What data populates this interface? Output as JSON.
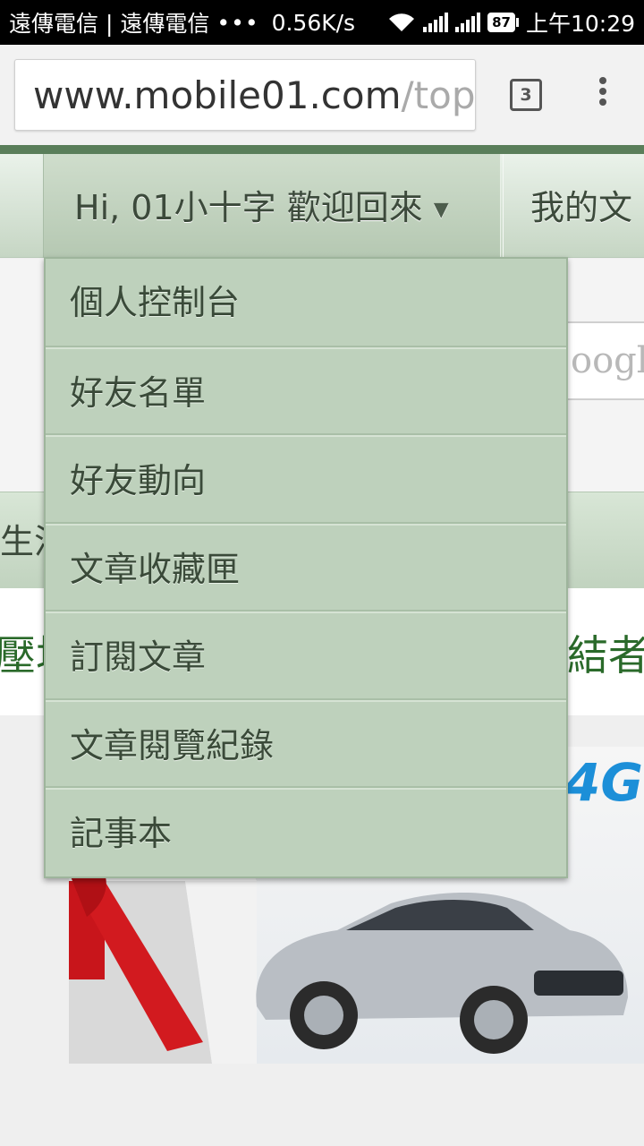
{
  "status_bar": {
    "carriers": "遠傳電信 | 遠傳電信",
    "more": "•••",
    "speed": "0.56K/s",
    "battery": "87",
    "time": "上午10:29"
  },
  "browser": {
    "url_host": "www.mobile01.com",
    "url_path": "/topic",
    "tab_count": "3"
  },
  "nav": {
    "user_greeting": "Hi, 01小十字 歡迎回來",
    "caret": "▼",
    "my_posts": "我的文"
  },
  "search_partial": "oogl",
  "category_partial": "生活",
  "headline": {
    "left_partial": "壓垃",
    "right_partial": "結者"
  },
  "ad": {
    "brand_text": "4G"
  },
  "dropdown": {
    "items": [
      "個人控制台",
      "好友名單",
      "好友動向",
      "文章收藏匣",
      "訂閱文章",
      "文章閱覽紀錄",
      "記事本"
    ]
  }
}
